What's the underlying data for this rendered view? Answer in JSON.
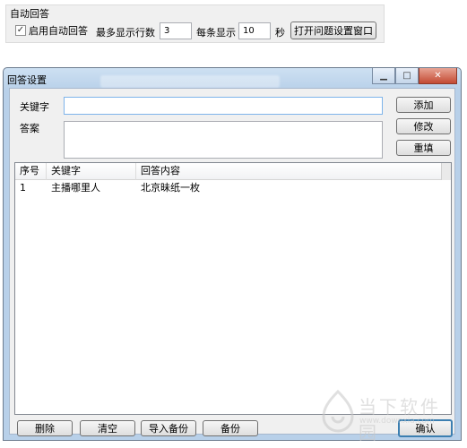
{
  "top_panel": {
    "title": "自动回答",
    "enable_checkbox_label": "启用自动回答",
    "enable_checked": true,
    "max_lines_label": "最多显示行数",
    "max_lines_value": "3",
    "per_item_label": "每条显示",
    "per_item_value": "10",
    "seconds_unit": "秒",
    "open_window_button": "打开问题设置窗口"
  },
  "dialog": {
    "title": "回答设置",
    "keyword_label": "关键字",
    "answer_label": "答案",
    "keyword_value": "",
    "answer_value": "",
    "add_button": "添加",
    "modify_button": "修改",
    "reset_button": "重填",
    "columns": [
      "序号",
      "关键字",
      "回答内容"
    ],
    "rows": [
      {
        "index": "1",
        "keyword": "主播哪里人",
        "answer": "北京昧纸一枚"
      }
    ],
    "delete_button": "删除",
    "clear_button": "清空",
    "import_backup_button": "导入备份",
    "backup_button": "备份",
    "confirm_button": "确认"
  },
  "watermark": {
    "text": "当下软件园",
    "url": "www.downxia.com"
  }
}
